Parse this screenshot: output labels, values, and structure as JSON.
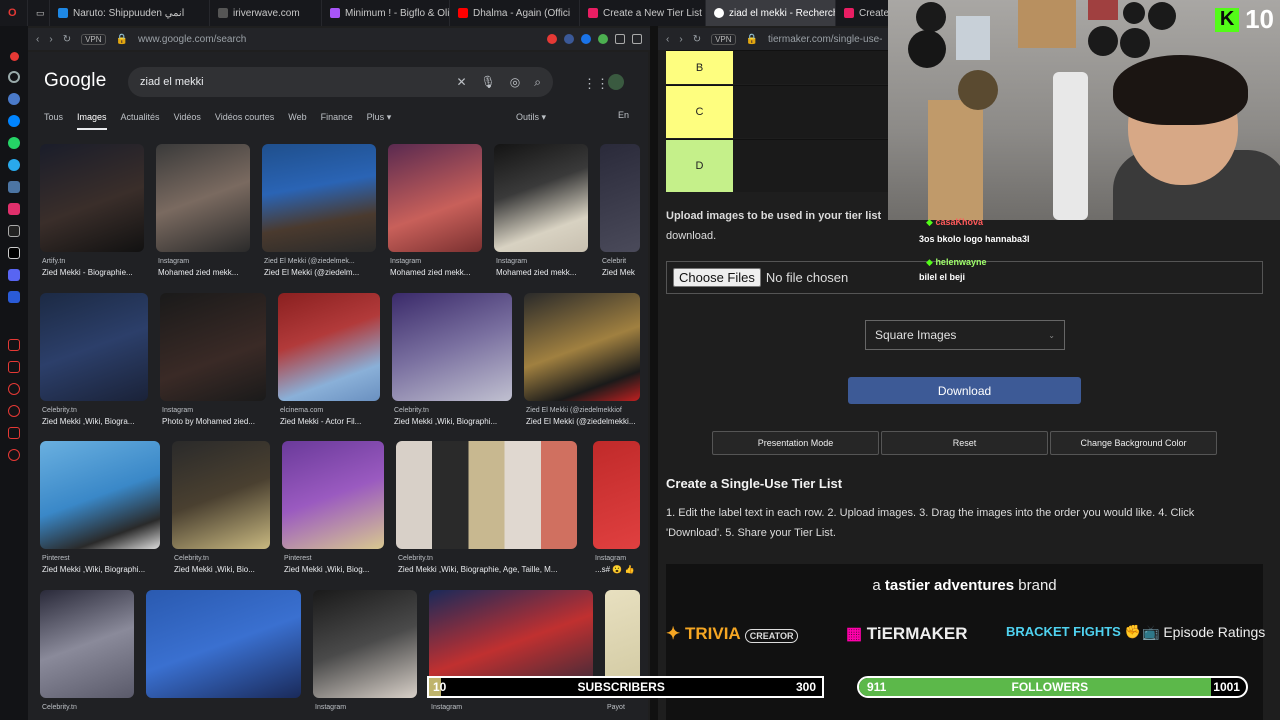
{
  "tabs": [
    {
      "label": "Naruto: Shippuuden انمي",
      "color": "#1e88e5"
    },
    {
      "label": "iriverwave.com",
      "color": "#888888"
    },
    {
      "label": "Minimum ! - Bigflo & Oli -",
      "color": "#a855f7"
    },
    {
      "label": "Dhalma - Again (Offici",
      "color": "#ff0000"
    },
    {
      "label": "Create a New Tier List - Ti",
      "color": "#e91e63"
    },
    {
      "label": "ziad el mekki - Recherche",
      "color": "#4285f4",
      "active": true
    },
    {
      "label": "Create a Si",
      "color": "#e91e63"
    }
  ],
  "left_browser": {
    "vpn": "VPN",
    "url": "www.google.com/search"
  },
  "google": {
    "logo": "Google",
    "query": "ziad el mekki",
    "tabs": [
      "Tous",
      "Images",
      "Actualités",
      "Vidéos",
      "Vidéos courtes",
      "Web",
      "Finance",
      "Plus"
    ],
    "active_tab": "Images",
    "tools": "Outils",
    "lang": "En",
    "results": [
      {
        "src": "Artify.tn",
        "title": "Zied Mekki - Biographie..."
      },
      {
        "src": "Instagram",
        "title": "Mohamed zied mekk..."
      },
      {
        "src": "Zied El Mekki (@ziedelmek...",
        "title": "Zied El Mekki (@ziedelm..."
      },
      {
        "src": "Instagram",
        "title": "Mohamed zied mekk..."
      },
      {
        "src": "Instagram",
        "title": "Mohamed zied mekk..."
      },
      {
        "src": "Celebrit",
        "title": "Zied Mek"
      },
      {
        "src": "Celebrity.tn",
        "title": "Zied Mekki ,Wiki, Biogra..."
      },
      {
        "src": "Instagram",
        "title": "Photo by Mohamed zied..."
      },
      {
        "src": "elcinema.com",
        "title": "Zied Mekki - Actor Fil..."
      },
      {
        "src": "Celebrity.tn",
        "title": "Zied Mekki ,Wiki, Biographi..."
      },
      {
        "src": "Zied El Mekki (@ziedelmekkiof",
        "title": "Zied El Mekki (@ziedelmekki..."
      },
      {
        "src": "Pinterest",
        "title": "Zied Mekki ,Wiki, Biographi..."
      },
      {
        "src": "Celebrity.tn",
        "title": "Zied Mekki ,Wiki, Bio..."
      },
      {
        "src": "Pinterest",
        "title": "Zied Mekki ,Wiki, Biog..."
      },
      {
        "src": "Celebrity.tn",
        "title": "Zied Mekki ,Wiki, Biographie, Age, Taille, M..."
      },
      {
        "src": "Instagram",
        "title": "...s# 😮 👍"
      },
      {
        "src": "Celebrity.tn",
        "title": ""
      },
      {
        "src": "Instagram",
        "title": ""
      },
      {
        "src": "Instagram",
        "title": ""
      },
      {
        "src": "Payot",
        "title": ""
      }
    ]
  },
  "right_browser": {
    "vpn": "VPN",
    "url": "tiermaker.com/single-use-ti"
  },
  "tiermaker": {
    "tiers": [
      {
        "label": "B",
        "color": "#fefe7f"
      },
      {
        "label": "C",
        "color": "#fefe7f"
      },
      {
        "label": "D",
        "color": "#c5f08a"
      }
    ],
    "upload_text_1": "Upload images to be used in your tier list",
    "upload_text_2": "download.",
    "choose_files": "Choose Files",
    "no_file": "No file chosen",
    "shape_select": "Square Images",
    "download": "Download",
    "presentation_mode": "Presentation Mode",
    "reset": "Reset",
    "change_bg": "Change Background Color",
    "heading": "Create a Single-Use Tier List",
    "instructions_1": "1. Edit the label text in each row. 2. Upload images. 3. Drag the images into the order you would like. 4. Click",
    "instructions_2": "'Download'. 5. Share your Tier List.",
    "brand_prefix": "a",
    "brand_name": "tastier adventures",
    "brand_suffix": "brand",
    "logos": [
      "TRIVIA",
      "CREATOR",
      "TiERMAKER",
      "BRACKET FIGHTS",
      "Episode Ratings"
    ]
  },
  "stream": {
    "kick_letter": "K",
    "viewer_count": "10",
    "chat": [
      {
        "user": "casaKhova",
        "user_color": "#ff5a5a",
        "message": "3os bkolo logo hannaba3l"
      },
      {
        "user": "helenwayne",
        "user_color": "#9fff6a",
        "message": "bilel el beji"
      }
    ],
    "subscribers": {
      "label": "SUBSCRIBERS",
      "current": "10",
      "goal": "300",
      "progress": 0.03
    },
    "followers": {
      "label": "FOLLOWERS",
      "current": "911",
      "goal": "1001",
      "progress": 0.91
    }
  }
}
